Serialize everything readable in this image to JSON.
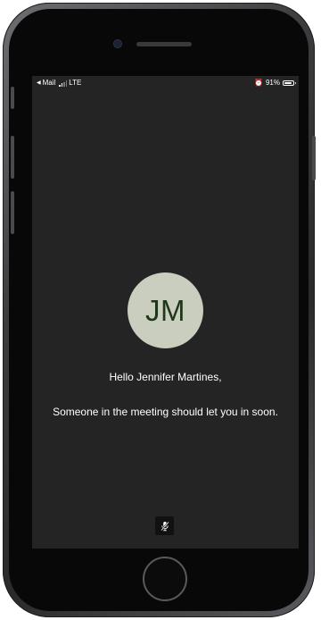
{
  "status_bar": {
    "back_app": "Mail",
    "carrier": "LTE",
    "battery_percent": "91%",
    "battery_level": 0.91,
    "signal_bars": 4,
    "signal_active": 2
  },
  "meeting": {
    "avatar_initials": "JM",
    "greeting": "Hello Jennifer Martines,",
    "waiting_message": "Someone in the meeting should let you in soon."
  },
  "controls": {
    "mic_icon": "mic-muted-icon"
  },
  "colors": {
    "screen_background": "#242424",
    "avatar_background": "#c9cebf",
    "avatar_text": "#1f3618"
  }
}
